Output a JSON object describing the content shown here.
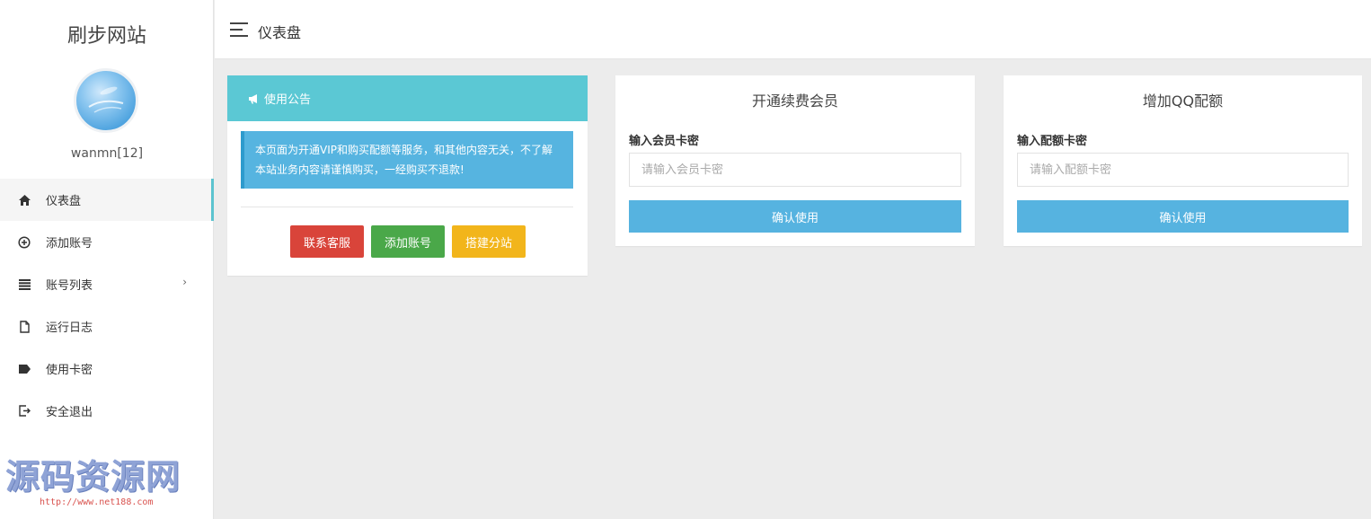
{
  "sidebar": {
    "brand": "刷步网站",
    "username": "wanmn[12]",
    "items": [
      {
        "label": "仪表盘",
        "icon": "home-icon",
        "active": true
      },
      {
        "label": "添加账号",
        "icon": "plus-circle-icon"
      },
      {
        "label": "账号列表",
        "icon": "list-icon",
        "has_submenu": true,
        "arrow": "›"
      },
      {
        "label": "运行日志",
        "icon": "file-icon"
      },
      {
        "label": "使用卡密",
        "icon": "tag-icon"
      },
      {
        "label": "安全退出",
        "icon": "logout-icon"
      }
    ]
  },
  "watermark": {
    "title": "源码资源网",
    "url": "http://www.net188.com"
  },
  "topbar": {
    "title": "仪表盘"
  },
  "notice": {
    "title": "使用公告",
    "text": "本页面为开通VIP和购买配额等服务，和其他内容无关，不了解本站业务内容请谨慎购买，一经购买不退款!",
    "buttons": {
      "contact": "联系客服",
      "add_account": "添加账号",
      "build_site": "搭建分站"
    }
  },
  "vip": {
    "title": "开通续费会员",
    "label": "输入会员卡密",
    "placeholder": "请输入会员卡密",
    "submit": "确认使用"
  },
  "quota": {
    "title": "增加QQ配额",
    "label": "输入配额卡密",
    "placeholder": "请输入配额卡密",
    "submit": "确认使用"
  },
  "colors": {
    "accent": "#5bc8d4",
    "notice_bg": "#56b4e0",
    "danger": "#d9443a",
    "success": "#4aa849",
    "warning": "#f2b51b",
    "primary": "#56b3e0"
  }
}
